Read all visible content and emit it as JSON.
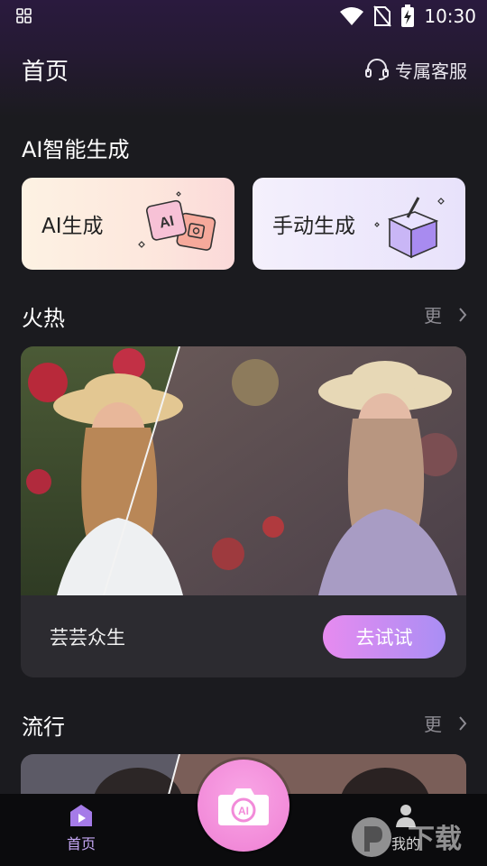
{
  "status_bar": {
    "time": "10:30"
  },
  "header": {
    "title": "首页",
    "service_label": "专属客服"
  },
  "ai_section": {
    "title": "AI智能生成",
    "cards": [
      {
        "label": "AI生成"
      },
      {
        "label": "手动生成"
      }
    ],
    "badge_text": "AI"
  },
  "hot_section": {
    "title": "火热",
    "more_label": "更",
    "caption": "芸芸众生",
    "try_label": "去试试"
  },
  "popular_section": {
    "title": "流行",
    "more_label": "更"
  },
  "bottom_nav": {
    "home_label": "首页",
    "mine_label": "我的",
    "camera_badge": "AI"
  },
  "watermark": {
    "text": "下载"
  },
  "colors": {
    "accent": "#c4a6f3",
    "try_gradient_start": "#e78bf0",
    "try_gradient_end": "#a98ef4",
    "fab": "#f28bd9"
  }
}
